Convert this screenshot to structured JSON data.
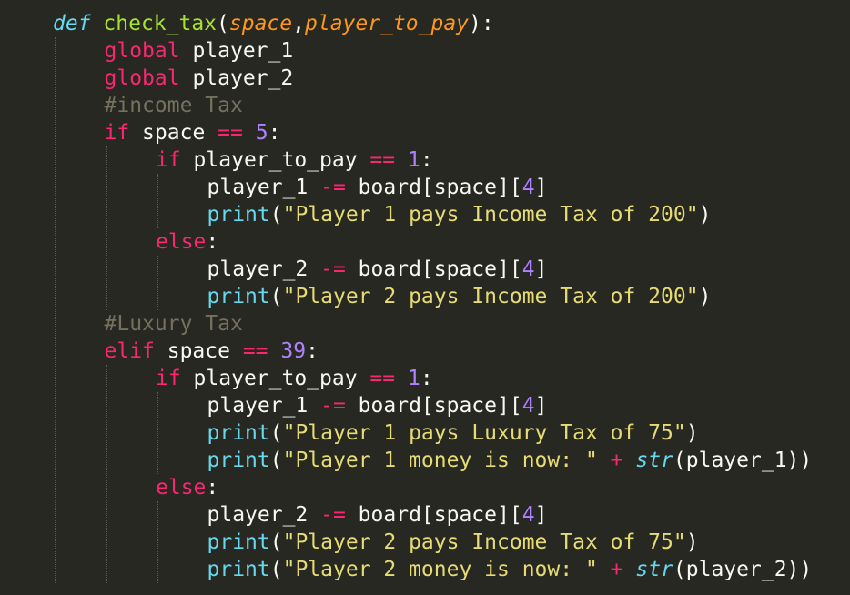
{
  "editor": {
    "lines": [
      [
        [
          "def",
          "def"
        ],
        [
          "sp",
          " "
        ],
        [
          "fn",
          "check_tax"
        ],
        [
          "p",
          "("
        ],
        [
          "param",
          "space"
        ],
        [
          "p",
          ","
        ],
        [
          "param",
          "player_to_pay"
        ],
        [
          "p",
          "):"
        ]
      ],
      [
        [
          "kw",
          "global"
        ],
        [
          "p",
          " player_1"
        ]
      ],
      [
        [
          "kw",
          "global"
        ],
        [
          "p",
          " player_2"
        ]
      ],
      [
        [
          "cmt",
          "#income Tax"
        ]
      ],
      [
        [
          "kw",
          "if"
        ],
        [
          "p",
          " space "
        ],
        [
          "op",
          "=="
        ],
        [
          "p",
          " "
        ],
        [
          "num",
          "5"
        ],
        [
          "p",
          ":"
        ]
      ],
      [
        [
          "kw",
          "if"
        ],
        [
          "p",
          " player_to_pay "
        ],
        [
          "op",
          "=="
        ],
        [
          "p",
          " "
        ],
        [
          "num",
          "1"
        ],
        [
          "p",
          ":"
        ]
      ],
      [
        [
          "p",
          "player_1 "
        ],
        [
          "op",
          "-="
        ],
        [
          "p",
          " board[space]["
        ],
        [
          "num",
          "4"
        ],
        [
          "p",
          "]"
        ]
      ],
      [
        [
          "builtin",
          "print"
        ],
        [
          "p",
          "("
        ],
        [
          "str",
          "\"Player 1 pays Income Tax of 200\""
        ],
        [
          "p",
          ")"
        ]
      ],
      [
        [
          "kw",
          "else"
        ],
        [
          "p",
          ":"
        ]
      ],
      [
        [
          "p",
          "player_2 "
        ],
        [
          "op",
          "-="
        ],
        [
          "p",
          " board[space]["
        ],
        [
          "num",
          "4"
        ],
        [
          "p",
          "]"
        ]
      ],
      [
        [
          "builtin",
          "print"
        ],
        [
          "p",
          "("
        ],
        [
          "str",
          "\"Player 2 pays Income Tax of 200\""
        ],
        [
          "p",
          ")"
        ]
      ],
      [
        [
          "cmt",
          "#Luxury Tax"
        ]
      ],
      [
        [
          "kw",
          "elif"
        ],
        [
          "p",
          " space "
        ],
        [
          "op",
          "=="
        ],
        [
          "p",
          " "
        ],
        [
          "num",
          "39"
        ],
        [
          "p",
          ":"
        ]
      ],
      [
        [
          "kw",
          "if"
        ],
        [
          "p",
          " player_to_pay "
        ],
        [
          "op",
          "=="
        ],
        [
          "p",
          " "
        ],
        [
          "num",
          "1"
        ],
        [
          "p",
          ":"
        ]
      ],
      [
        [
          "p",
          "player_1 "
        ],
        [
          "op",
          "-="
        ],
        [
          "p",
          " board[space]["
        ],
        [
          "num",
          "4"
        ],
        [
          "p",
          "]"
        ]
      ],
      [
        [
          "builtin",
          "print"
        ],
        [
          "p",
          "("
        ],
        [
          "str",
          "\"Player 1 pays Luxury Tax of 75\""
        ],
        [
          "p",
          ")"
        ]
      ],
      [
        [
          "builtin",
          "print"
        ],
        [
          "p",
          "("
        ],
        [
          "str",
          "\"Player 1 money is now: \""
        ],
        [
          "p",
          " "
        ],
        [
          "op",
          "+"
        ],
        [
          "p",
          " "
        ],
        [
          "builtin-it",
          "str"
        ],
        [
          "p",
          "(player_1))"
        ]
      ],
      [
        [
          "kw",
          "else"
        ],
        [
          "p",
          ":"
        ]
      ],
      [
        [
          "p",
          "player_2 "
        ],
        [
          "op",
          "-="
        ],
        [
          "p",
          " board[space]["
        ],
        [
          "num",
          "4"
        ],
        [
          "p",
          "]"
        ]
      ],
      [
        [
          "builtin",
          "print"
        ],
        [
          "p",
          "("
        ],
        [
          "str",
          "\"Player 2 pays Income Tax of 75\""
        ],
        [
          "p",
          ")"
        ]
      ],
      [
        [
          "builtin",
          "print"
        ],
        [
          "p",
          "("
        ],
        [
          "str",
          "\"Player 2 money is now: \""
        ],
        [
          "p",
          " "
        ],
        [
          "op",
          "+"
        ],
        [
          "p",
          " "
        ],
        [
          "builtin-it",
          "str"
        ],
        [
          "p",
          "(player_2))"
        ]
      ]
    ],
    "indents": [
      0,
      1,
      1,
      1,
      1,
      2,
      3,
      3,
      2,
      3,
      3,
      1,
      1,
      2,
      3,
      3,
      3,
      2,
      3,
      3,
      3
    ]
  }
}
